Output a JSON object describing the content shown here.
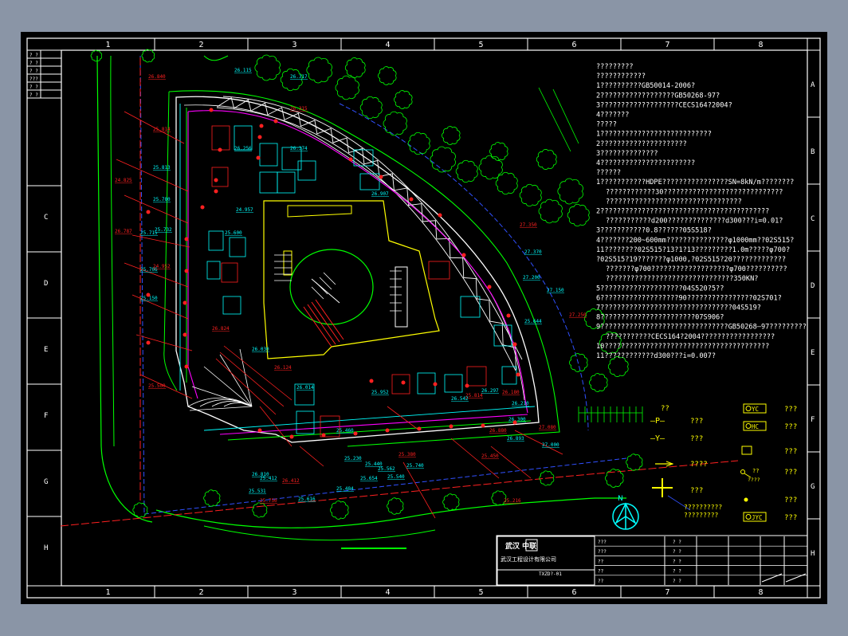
{
  "grid": {
    "cols": [
      "1",
      "2",
      "3",
      "4",
      "5",
      "6",
      "7",
      "8"
    ],
    "rows": [
      "A",
      "B",
      "C",
      "D",
      "E",
      "F",
      "G",
      "H"
    ],
    "rows_left": [
      "C",
      "D",
      "E",
      "F",
      "G",
      "H"
    ]
  },
  "revision_table": [
    "? ?",
    "? ?",
    "? ?",
    "???",
    "? ?",
    "? ?"
  ],
  "notes": {
    "lines": [
      "?????????",
      "????????????",
      "1??????????GB50014-2006?",
      "2??????????????????GB50268-97?",
      "3???????????????????CECS164?2004?",
      "4???????",
      "?????",
      "1???????????????????????????",
      "2?????????????????????",
      "3??????????????",
      "4???????????????????????",
      "??????",
      "1???????????HDPE????????????????SN=8kN/m????????",
      "????????????30?????????????????????????????",
      "?????????????????????????????????",
      "2?????????????????????????????????????????",
      "???????????d200??????????????d300???i=0.01?",
      "3???????????0.8??????05S518?",
      "4???????200~600mm???????????????φ1000mm??02S515?",
      "11????????02S515?13?1?13?????????1.0m?????φ700?",
      "?02S515?19???????φ1000,?02S515?20?????????????",
      "???????φ700???????????????????φ700??????????",
      "???????????????????????????????350KN?",
      "5????????????????????04S520?5??",
      "6???????????????????90????????????????02S701?",
      "7????????????????????????????????04S519?",
      "8???????????????????????07S906?",
      "9???????????????????????????????GB50268—97?????????",
      "???????????CECS164?2004??????????????????",
      "10????????????????????????????????????????",
      "11????????????d300???i=0.007?"
    ]
  },
  "legend": {
    "header": "??",
    "left": [
      {
        "symbol": "—P—",
        "label": "???"
      },
      {
        "symbol": "—Y—",
        "label": "???"
      },
      {
        "symbol": "pipe-arrow",
        "label": "????"
      },
      {
        "symbol": "cross",
        "label": "???"
      }
    ],
    "right": [
      {
        "symbol": "YC",
        "label": "???"
      },
      {
        "symbol": "HC",
        "label": "???"
      },
      {
        "symbol": "box",
        "label": "???"
      },
      {
        "symbol": "??",
        "sublabel": "????",
        "label": "???"
      },
      {
        "symbol": "dot",
        "label": "???"
      },
      {
        "symbol": "JYC",
        "label": "???"
      }
    ],
    "callout": [
      "??????????",
      "?????????"
    ]
  },
  "north_arrow": "N",
  "title_block": {
    "company_logo_text": "武汉 中联",
    "company_name": "武汉工程设计有限公司",
    "project_no": "TXZD?-01",
    "rows": [
      "???",
      "???",
      "??",
      "??",
      "??"
    ],
    "mid_rows": [
      "? ?",
      "? ?",
      "? ?",
      "? ?",
      "? ?"
    ]
  },
  "plan_labels": [
    "26.840",
    "26.115",
    "26.317",
    "26.315",
    "26.256",
    "26.374",
    "25.814",
    "25.813",
    "25.780",
    "24.825",
    "25.732",
    "25.715",
    "26.787",
    "24.957",
    "25.706",
    "24.952",
    "25.600",
    "26.907",
    "27.350",
    "27.370",
    "25.150",
    "26.824",
    "27.200",
    "25.644",
    "27.250",
    "27.150",
    "26.030",
    "26.124",
    "26.014",
    "25.952",
    "25.814",
    "26.542",
    "26.297",
    "26.180",
    "26.210",
    "26.300",
    "25.500",
    "25.460",
    "25.562",
    "25.380",
    "25.412",
    "25.531",
    "25.750",
    "25.616",
    "25.484",
    "25.216",
    "25.740",
    "25.654",
    "25.450",
    "25.230",
    "26.810",
    "26.412",
    "25.540",
    "25.440",
    "27.080",
    "27.000",
    "26.893",
    "26.880"
  ],
  "colors": {
    "background": "#000000",
    "frame": "#ffffff",
    "cyan": "#00ffff",
    "red": "#ff2020",
    "green": "#00ff00",
    "yellow": "#ffff00",
    "magenta": "#ff00ff",
    "blue": "#3050ff"
  }
}
